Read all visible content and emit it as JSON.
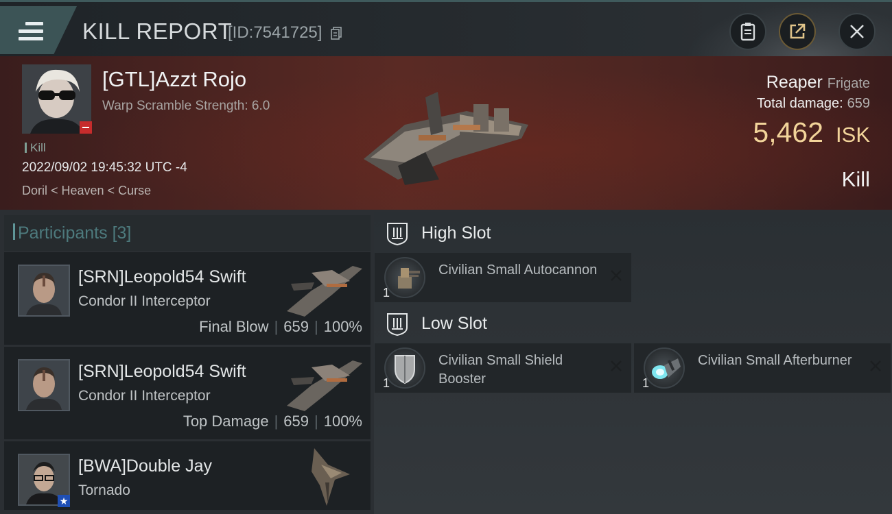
{
  "header": {
    "title": "KILL REPORT",
    "report_id": "[ID:7541725]",
    "icons": [
      "menu-icon",
      "clipboard-icon",
      "share-icon",
      "close-icon"
    ]
  },
  "victim": {
    "name": "[GTL]Azzt Rojo",
    "subtitle": "Warp Scramble Strength: 6.0",
    "kill_tag": "Kill",
    "datetime": "2022/09/02 19:45:32 UTC -4",
    "location": "Doril < Heaven < Curse",
    "ship_name": "Reaper",
    "ship_class": "Frigate",
    "total_damage_label": "Total damage:",
    "total_damage_value": "659",
    "isk_value": "5,462",
    "isk_unit": "ISK",
    "result": "Kill"
  },
  "participants": {
    "title": "Participants",
    "count": "[3]",
    "items": [
      {
        "name": "[SRN]Leopold54 Swift",
        "ship": "Condor II Interceptor",
        "role": "Final Blow",
        "damage": "659",
        "percent": "100%"
      },
      {
        "name": "[SRN]Leopold54 Swift",
        "ship": "Condor II Interceptor",
        "role": "Top Damage",
        "damage": "659",
        "percent": "100%"
      },
      {
        "name": "[BWA]Double Jay",
        "ship": "Tornado"
      }
    ]
  },
  "fitting": {
    "high_slot": {
      "title": "High Slot",
      "modules": [
        {
          "qty": "1",
          "name": "Civilian Small Autocannon"
        }
      ]
    },
    "low_slot": {
      "title": "Low Slot",
      "modules": [
        {
          "qty": "1",
          "name": "Civilian Small Shield Booster"
        },
        {
          "qty": "1",
          "name": "Civilian Small Afterburner"
        }
      ]
    }
  },
  "colors": {
    "accent": "#3c5456",
    "isk": "#f2d49a",
    "banner": "#5a2a24"
  }
}
